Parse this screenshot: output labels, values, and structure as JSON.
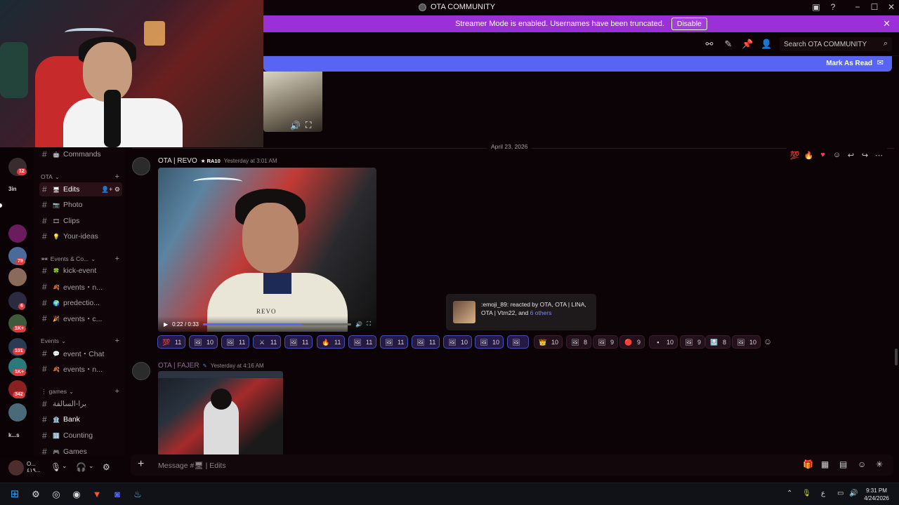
{
  "window": {
    "title": "OTA COMMUNITY",
    "controls": [
      "−",
      "☐",
      "✕"
    ]
  },
  "banner": {
    "text": "Streamer Mode is enabled. Usernames have been truncated.",
    "button": "Disable",
    "color": "#9b2fd8"
  },
  "header": {
    "search_placeholder": "Search OTA COMMUNITY",
    "mark_as_read": "Mark As Read"
  },
  "rail": {
    "badges": [
      "12",
      "79",
      "6",
      "1K+",
      "101",
      "1K+",
      "342"
    ],
    "text_server": "3in",
    "text_server2": "k...s"
  },
  "channels": {
    "top": {
      "name": "Commands",
      "emoji": "🤖"
    },
    "cat_ota": "OTA",
    "edits": {
      "name": "Edits",
      "emoji": "🖥"
    },
    "photo": {
      "name": "Photo",
      "emoji": "📷"
    },
    "clips": {
      "name": "Clips",
      "emoji": "🎞"
    },
    "ideas": {
      "name": "Your-ideas",
      "emoji": "💡"
    },
    "cat_events_co": "Events & Co...",
    "kick_event": {
      "name": "kick-event",
      "emoji": "🍀"
    },
    "events_n": {
      "name": "events・n...",
      "emoji": "🍂"
    },
    "prediction": {
      "name": "predectio...",
      "emoji": "🌍"
    },
    "events_c": {
      "name": "events・c...",
      "emoji": "🎉"
    },
    "cat_events": "Events",
    "event_chat": {
      "name": "event・Chat",
      "emoji": "💬"
    },
    "events_n2": {
      "name": "events・n...",
      "emoji": "🍂"
    },
    "cat_games": "games",
    "arabic": {
      "name": "برا-السالفة"
    },
    "bank": {
      "name": "Bank",
      "emoji": "🏦"
    },
    "counting": {
      "name": "Counting",
      "emoji": "🔢"
    },
    "games": {
      "name": "Games",
      "emoji": "🎮"
    }
  },
  "user_panel": {
    "name_line1": "O...",
    "name_line2": "٤١٩..."
  },
  "messages": {
    "date_divider": "April 23, 2026",
    "msg1": {
      "author": "OTA | REVO",
      "tag": "RA10",
      "time": "Yesterday at 3:01 AM",
      "video_time": "0:22 / 0:33",
      "video_progress": 0.667,
      "watermark": "REVO"
    },
    "msg2": {
      "author": "OTA | FAJER",
      "time": "Yesterday at 4:16 AM"
    },
    "tooltip": {
      "text": ":emoji_89: reacted by OTA, OTA | LINA, OTA | Vtrn22, and",
      "link": "6 others"
    },
    "reactions": [
      {
        "icon": "💯",
        "count": "11",
        "me": true
      },
      {
        "icon": "🖼",
        "count": "10",
        "me": true
      },
      {
        "icon": "🖼",
        "count": "11",
        "me": true
      },
      {
        "icon": "⚔",
        "count": "11",
        "me": true
      },
      {
        "icon": "🖼",
        "count": "11",
        "me": true
      },
      {
        "icon": "🔥",
        "count": "11",
        "me": true
      },
      {
        "icon": "🖼",
        "count": "11",
        "me": true
      },
      {
        "icon": "🖼",
        "count": "11",
        "me": true
      },
      {
        "icon": "🖼",
        "count": "11",
        "me": true
      },
      {
        "icon": "🖼",
        "count": "10",
        "me": true
      },
      {
        "icon": "🖼",
        "count": "10",
        "me": true
      },
      {
        "icon": "🖼",
        "count": "",
        "me": true
      },
      {
        "icon": "👑",
        "count": "10",
        "me": false
      },
      {
        "icon": "🖼",
        "count": "8",
        "me": false
      },
      {
        "icon": "🖼",
        "count": "9",
        "me": false
      },
      {
        "icon": "🔴",
        "count": "9",
        "me": false
      },
      {
        "icon": "▪",
        "count": "10",
        "me": false
      },
      {
        "icon": "🖼",
        "count": "9",
        "me": false
      },
      {
        "icon": "🔝",
        "count": "8",
        "me": false
      },
      {
        "icon": "🖼",
        "count": "10",
        "me": false
      }
    ]
  },
  "composer": {
    "placeholder": "Message #🖥 | Edits"
  },
  "taskbar": {
    "time": "9:31 PM",
    "date": "4/24/2026",
    "lang": "ع"
  }
}
